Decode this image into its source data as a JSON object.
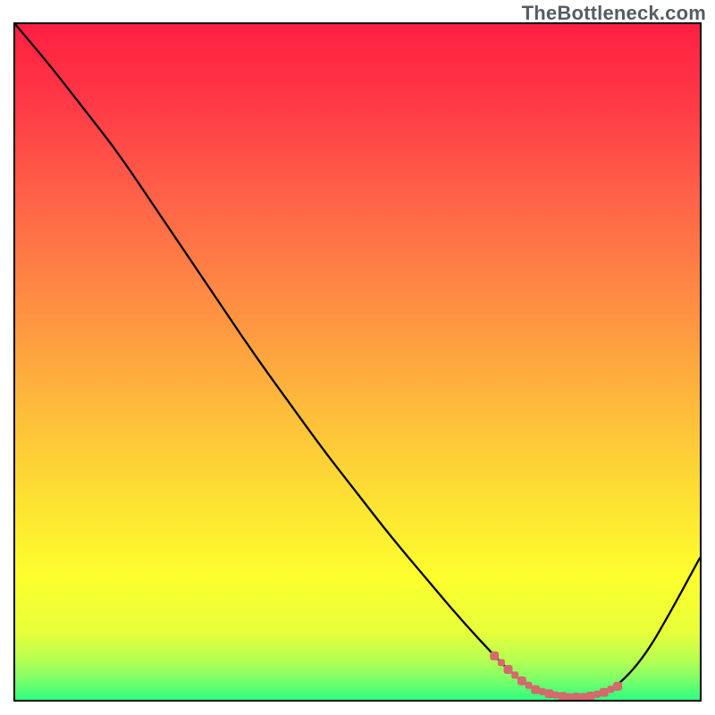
{
  "watermark": "TheBottleneck.com",
  "chart_data": {
    "type": "line",
    "title": "",
    "xlabel": "",
    "ylabel": "",
    "xlim": [
      0,
      100
    ],
    "ylim": [
      0,
      100
    ],
    "grid": false,
    "legend": false,
    "series": [
      {
        "name": "curve",
        "color": "#000000",
        "x": [
          0,
          5,
          10,
          15,
          20,
          25,
          30,
          35,
          40,
          45,
          50,
          55,
          60,
          65,
          70,
          73,
          76,
          79,
          82,
          85,
          88,
          92,
          96,
          100
        ],
        "y": [
          100,
          94,
          87.5,
          81,
          73.5,
          66,
          58.5,
          51,
          44,
          37,
          30.5,
          24,
          18,
          12,
          6.5,
          3.5,
          1.5,
          0.6,
          0.4,
          0.6,
          2,
          6.5,
          13.5,
          21
        ]
      },
      {
        "name": "highlight",
        "color": "#d36a6b",
        "style": "dotted-thick",
        "x": [
          70,
          72,
          74,
          76,
          78,
          80,
          82,
          84,
          86,
          88
        ],
        "y": [
          6.5,
          4.5,
          2.8,
          1.5,
          0.9,
          0.5,
          0.4,
          0.55,
          1.1,
          2.0
        ]
      }
    ],
    "background_gradient": {
      "stops": [
        {
          "offset": 0.0,
          "color": "#ff1f43"
        },
        {
          "offset": 0.12,
          "color": "#ff3a46"
        },
        {
          "offset": 0.25,
          "color": "#ff6048"
        },
        {
          "offset": 0.4,
          "color": "#ff8a44"
        },
        {
          "offset": 0.55,
          "color": "#feb63c"
        },
        {
          "offset": 0.7,
          "color": "#fde033"
        },
        {
          "offset": 0.82,
          "color": "#fdff2d"
        },
        {
          "offset": 0.9,
          "color": "#e7ff3a"
        },
        {
          "offset": 0.94,
          "color": "#b8ff50"
        },
        {
          "offset": 0.97,
          "color": "#7dff6a"
        },
        {
          "offset": 1.0,
          "color": "#2dff7f"
        }
      ]
    }
  }
}
